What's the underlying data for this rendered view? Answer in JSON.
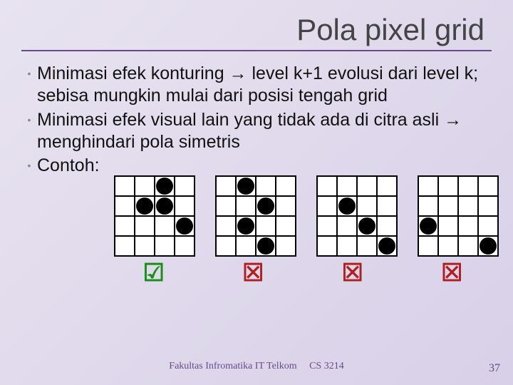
{
  "title": "Pola pixel grid",
  "bullets": [
    "Minimasi efek konturing → level k+1 evolusi dari level k; sebisa mungkin mulai dari posisi tengah grid",
    "Minimasi efek visual lain yang tidak ada di citra asli → menghindari pola simetris",
    "Contoh:"
  ],
  "grids": [
    {
      "cells": [
        0,
        0,
        1,
        0,
        0,
        1,
        1,
        0,
        0,
        0,
        0,
        1,
        0,
        0,
        0,
        0
      ],
      "mark": "check"
    },
    {
      "cells": [
        0,
        1,
        0,
        0,
        0,
        0,
        1,
        0,
        0,
        1,
        0,
        0,
        0,
        0,
        1,
        0
      ],
      "mark": "cross"
    },
    {
      "cells": [
        0,
        0,
        0,
        0,
        0,
        1,
        0,
        0,
        0,
        0,
        1,
        0,
        0,
        0,
        0,
        1
      ],
      "mark": "cross"
    },
    {
      "cells": [
        0,
        0,
        0,
        0,
        0,
        0,
        0,
        0,
        1,
        0,
        0,
        0,
        0,
        0,
        0,
        1
      ],
      "mark": "cross"
    }
  ],
  "marks": {
    "check": "☑",
    "cross": "☒"
  },
  "footer": {
    "left": "Fakultas Infromatika IT Telkom",
    "right": "CS 3214"
  },
  "pagenum": "37"
}
